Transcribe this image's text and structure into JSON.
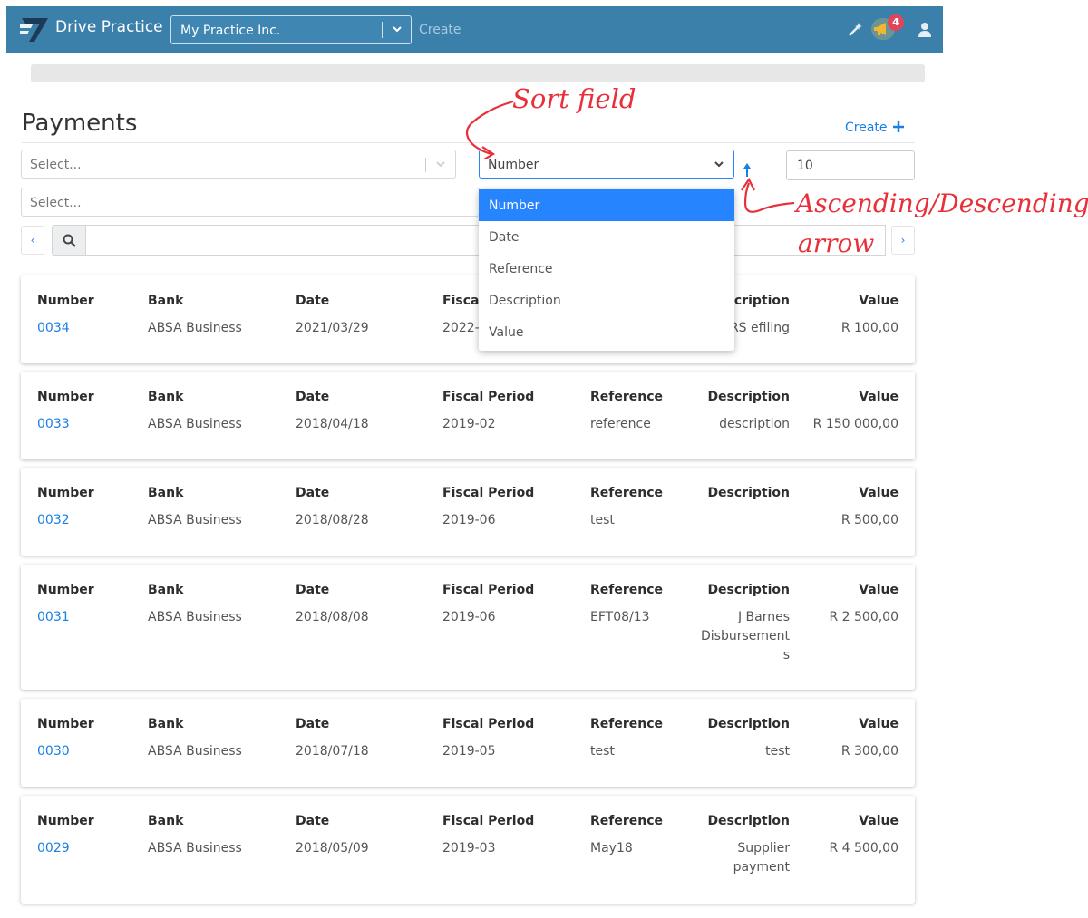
{
  "header": {
    "brand": "Drive Practice",
    "company": "My Practice Inc.",
    "create": "Create",
    "notification_count": "4",
    "icons": [
      "logo-icon",
      "chevron-down-icon",
      "magic-wand-icon",
      "megaphone-icon",
      "user-icon"
    ]
  },
  "page": {
    "title": "Payments",
    "create_label": "Create"
  },
  "filters": {
    "filter1_placeholder": "Select...",
    "filter2_placeholder": "Select...",
    "sort_field": "Number",
    "sort_direction": "ascending",
    "limit": "10"
  },
  "pager": {
    "prev": "‹",
    "next": "›"
  },
  "sort_options": [
    "Number",
    "Date",
    "Reference",
    "Description",
    "Value"
  ],
  "columns": [
    "Number",
    "Bank",
    "Date",
    "Fiscal Period",
    "Reference",
    "Description",
    "Value"
  ],
  "first_card_headers": {
    "fiscal": "Fiscal",
    "description": "scription"
  },
  "first_card_values": {
    "fiscal": "2022-",
    "description": "RS efiling"
  },
  "payments": [
    {
      "number": "0034",
      "bank": "ABSA Business",
      "date": "2021/03/29",
      "fiscal_period": "",
      "reference": "",
      "description": "",
      "value": "R 100,00"
    },
    {
      "number": "0033",
      "bank": "ABSA Business",
      "date": "2018/04/18",
      "fiscal_period": "2019-02",
      "reference": "reference",
      "description": "description",
      "value": "R 150 000,00"
    },
    {
      "number": "0032",
      "bank": "ABSA Business",
      "date": "2018/08/28",
      "fiscal_period": "2019-06",
      "reference": "test",
      "description": "",
      "value": "R 500,00"
    },
    {
      "number": "0031",
      "bank": "ABSA Business",
      "date": "2018/08/08",
      "fiscal_period": "2019-06",
      "reference": "EFT08/13",
      "description": "J Barnes\nDisbursement\ns",
      "value": "R 2 500,00"
    },
    {
      "number": "0030",
      "bank": "ABSA Business",
      "date": "2018/07/18",
      "fiscal_period": "2019-05",
      "reference": "test",
      "description": "test",
      "value": "R 300,00"
    },
    {
      "number": "0029",
      "bank": "ABSA Business",
      "date": "2018/05/09",
      "fiscal_period": "2019-03",
      "reference": "May18",
      "description": "Supplier\npayment",
      "value": "R 4 500,00"
    }
  ],
  "annotations": {
    "sort_field": "Sort field",
    "arrow_line1": "Ascending/Descending",
    "arrow_line2": "arrow"
  },
  "colors": {
    "topbar": "#3a80ab",
    "link": "#1a7fe5",
    "selected": "#2684ff",
    "annotation": "#e8303a",
    "badge": "#e0455a"
  }
}
